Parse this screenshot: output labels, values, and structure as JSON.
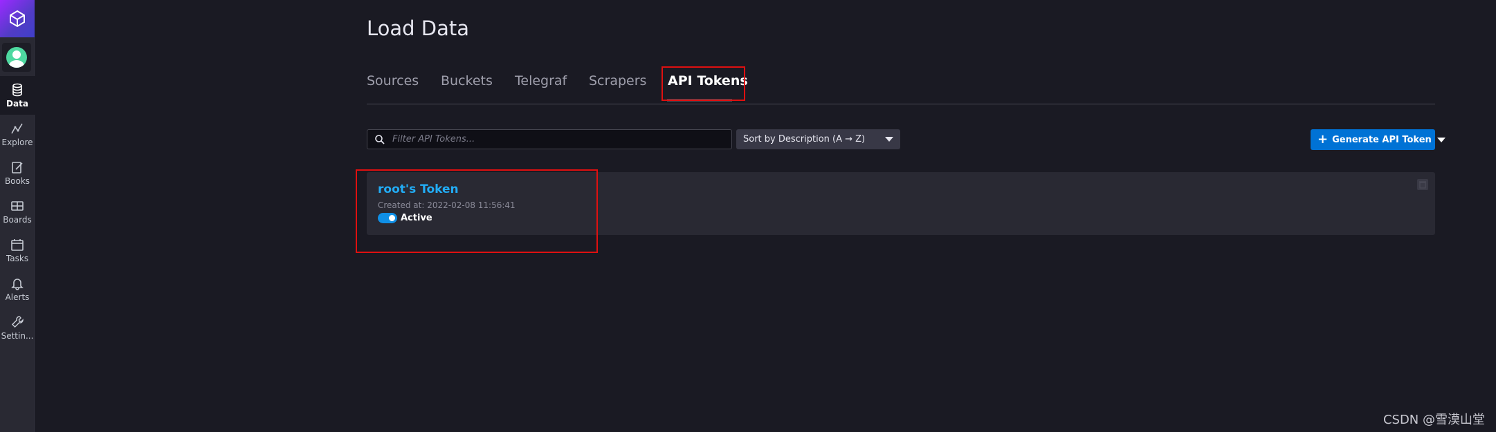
{
  "sidebar": {
    "logo_icon": "influx-cube-icon",
    "avatar_icon": "user-avatar-icon",
    "items": [
      {
        "label": "Data",
        "icon": "database-icon",
        "active": true
      },
      {
        "label": "Explore",
        "icon": "graph-line-icon",
        "active": false
      },
      {
        "label": "Books",
        "icon": "notebook-pencil-icon",
        "active": false
      },
      {
        "label": "Boards",
        "icon": "dashboard-grid-icon",
        "active": false
      },
      {
        "label": "Tasks",
        "icon": "calendar-icon",
        "active": false
      },
      {
        "label": "Alerts",
        "icon": "bell-icon",
        "active": false
      },
      {
        "label": "Settin...",
        "icon": "wrench-icon",
        "active": false
      }
    ]
  },
  "page": {
    "title": "Load Data"
  },
  "tabs": [
    {
      "label": "Sources",
      "active": false
    },
    {
      "label": "Buckets",
      "active": false
    },
    {
      "label": "Telegraf",
      "active": false
    },
    {
      "label": "Scrapers",
      "active": false
    },
    {
      "label": "API Tokens",
      "active": true
    }
  ],
  "toolbar": {
    "filter_placeholder": "Filter API Tokens...",
    "filter_value": "",
    "sort_label": "Sort by Description (A → Z)",
    "generate_label": "Generate API Token"
  },
  "tokens": [
    {
      "name": "root's Token",
      "created": "Created at: 2022-02-08 11:56:41",
      "status": "Active"
    }
  ],
  "watermark": "CSDN @雪漠山堂",
  "colors": {
    "accent": "#0072d5",
    "link": "#22adf6",
    "highlight_box": "#e01010",
    "background": "#1a1a23"
  }
}
